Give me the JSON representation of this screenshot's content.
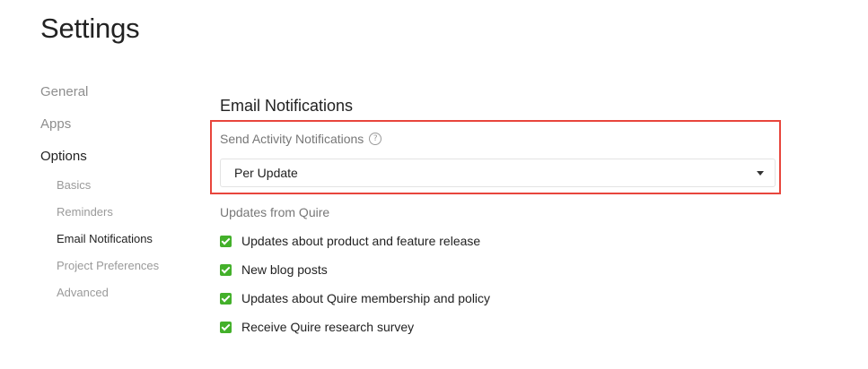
{
  "page": {
    "title": "Settings"
  },
  "sidebar": {
    "items": [
      {
        "label": "General"
      },
      {
        "label": "Apps"
      },
      {
        "label": "Options"
      }
    ],
    "sub_items": [
      {
        "label": "Basics"
      },
      {
        "label": "Reminders"
      },
      {
        "label": "Email Notifications"
      },
      {
        "label": "Project Preferences"
      },
      {
        "label": "Advanced"
      }
    ],
    "active_item": "Options",
    "active_sub_item": "Email Notifications"
  },
  "main": {
    "section_title": "Email Notifications",
    "activity": {
      "label": "Send Activity Notifications",
      "help_icon": "question-circle-icon",
      "selected_value": "Per Update"
    },
    "updates": {
      "label": "Updates from Quire",
      "options": [
        {
          "label": "Updates about product and feature release",
          "checked": true
        },
        {
          "label": "New blog posts",
          "checked": true
        },
        {
          "label": "Updates about Quire membership and policy",
          "checked": true
        },
        {
          "label": "Receive Quire research survey",
          "checked": true
        }
      ]
    }
  },
  "colors": {
    "highlight_border": "#e8453c",
    "checkbox": "#43b02a"
  }
}
